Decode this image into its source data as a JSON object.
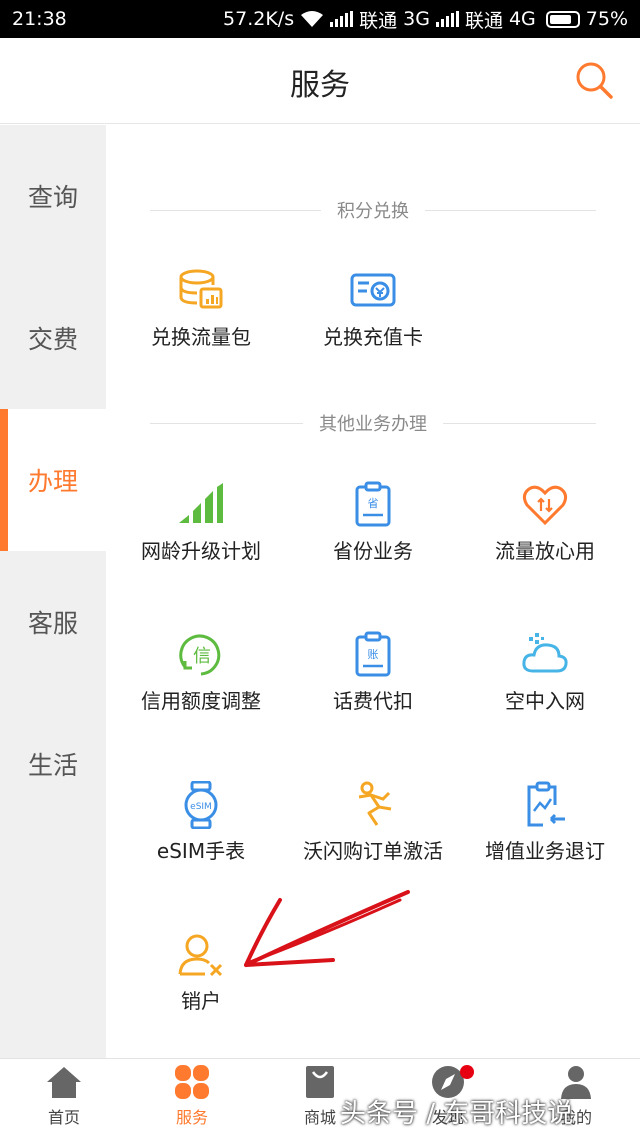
{
  "status": {
    "time": "21:38",
    "speed": "57.2K/s",
    "carrier1": "联通",
    "net1": "3G",
    "carrier2": "联通",
    "net2": "4G",
    "battery": "75%"
  },
  "header": {
    "title": "服务",
    "search_icon": "search-icon"
  },
  "sidebar": {
    "items": [
      {
        "label": "查询"
      },
      {
        "label": "交费"
      },
      {
        "label": "办理",
        "active": true
      },
      {
        "label": "客服"
      },
      {
        "label": "生活"
      }
    ]
  },
  "sections": {
    "points": {
      "title": "积分兑换",
      "items": [
        {
          "label": "兑换流量包",
          "icon": "data-package-icon"
        },
        {
          "label": "兑换充值卡",
          "icon": "recharge-card-icon"
        }
      ]
    },
    "other": {
      "title": "其他业务办理",
      "items": [
        {
          "label": "网龄升级计划",
          "icon": "signal-bars-icon"
        },
        {
          "label": "省份业务",
          "icon": "province-clipboard-icon"
        },
        {
          "label": "流量放心用",
          "icon": "heart-data-icon"
        },
        {
          "label": "信用额度调整",
          "icon": "credit-icon"
        },
        {
          "label": "话费代扣",
          "icon": "bill-clipboard-icon"
        },
        {
          "label": "空中入网",
          "icon": "cloud-icon"
        },
        {
          "label": "eSIM手表",
          "icon": "watch-icon"
        },
        {
          "label": "沃闪购订单激活",
          "icon": "running-man-icon"
        },
        {
          "label": "增值业务退订",
          "icon": "unsubscribe-icon"
        },
        {
          "label": "销户",
          "icon": "user-cancel-icon"
        }
      ]
    }
  },
  "bottom_nav": {
    "tabs": [
      {
        "label": "首页",
        "icon": "home-icon"
      },
      {
        "label": "服务",
        "icon": "grid-icon",
        "active": true
      },
      {
        "label": "商城",
        "icon": "shopping-bag-icon"
      },
      {
        "label": "发现",
        "icon": "compass-icon"
      },
      {
        "label": "我的",
        "icon": "user-icon"
      }
    ]
  },
  "watermark": "头条号 / 东哥科技说",
  "colors": {
    "accent": "#ff7a2f",
    "blue": "#3a8ee6",
    "green": "#5dbb3f",
    "yellow": "#f5a623",
    "sidebar_bg": "#f0f0f0",
    "annotation": "#d9121a"
  }
}
